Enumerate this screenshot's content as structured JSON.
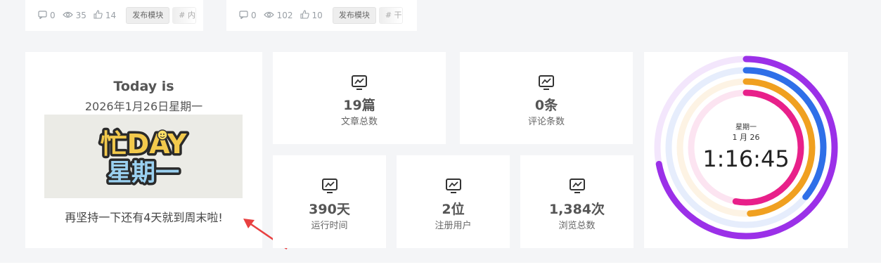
{
  "posts": [
    {
      "comments": "0",
      "views": "35",
      "likes": "14",
      "tag": "发布模块",
      "tag2": "# 内"
    },
    {
      "comments": "0",
      "views": "102",
      "likes": "10",
      "tag": "发布模块",
      "tag2": "# 干"
    }
  ],
  "today": {
    "title": "Today is",
    "date": "2026年1月26日星期一",
    "image_text_top": "忙DAY",
    "image_text_bottom": "星期一",
    "message": "再坚持一下还有4天就到周末啦!"
  },
  "stats": {
    "articles": {
      "value": "19篇",
      "label": "文章总数",
      "icon": "chart-monitor-icon"
    },
    "comments": {
      "value": "0条",
      "label": "评论条数",
      "icon": "chart-monitor-icon"
    },
    "runtime": {
      "value": "390天",
      "label": "运行时间",
      "icon": "chart-monitor-icon"
    },
    "users": {
      "value": "2位",
      "label": "注册用户",
      "icon": "chart-monitor-icon"
    },
    "views": {
      "value": "1,384次",
      "label": "浏览总数",
      "icon": "chart-monitor-icon"
    }
  },
  "clock": {
    "weekday": "星期一",
    "date": "1 月 26",
    "time": "1:16:45",
    "rings": [
      {
        "color": "#9b30e8",
        "fraction": 0.72
      },
      {
        "color": "#2f6fe8",
        "fraction": 0.36
      },
      {
        "color": "#f0a020",
        "fraction": 0.49
      },
      {
        "color": "#e8208a",
        "fraction": 0.53
      }
    ],
    "colors": {
      "accent_purple": "#9b30e8",
      "accent_blue": "#2f6fe8",
      "accent_orange": "#f0a020",
      "accent_pink": "#e8208a"
    }
  },
  "colors": {
    "page_bg": "#f4f5f7",
    "card_bg": "#ffffff",
    "arrow": "#e84040"
  }
}
